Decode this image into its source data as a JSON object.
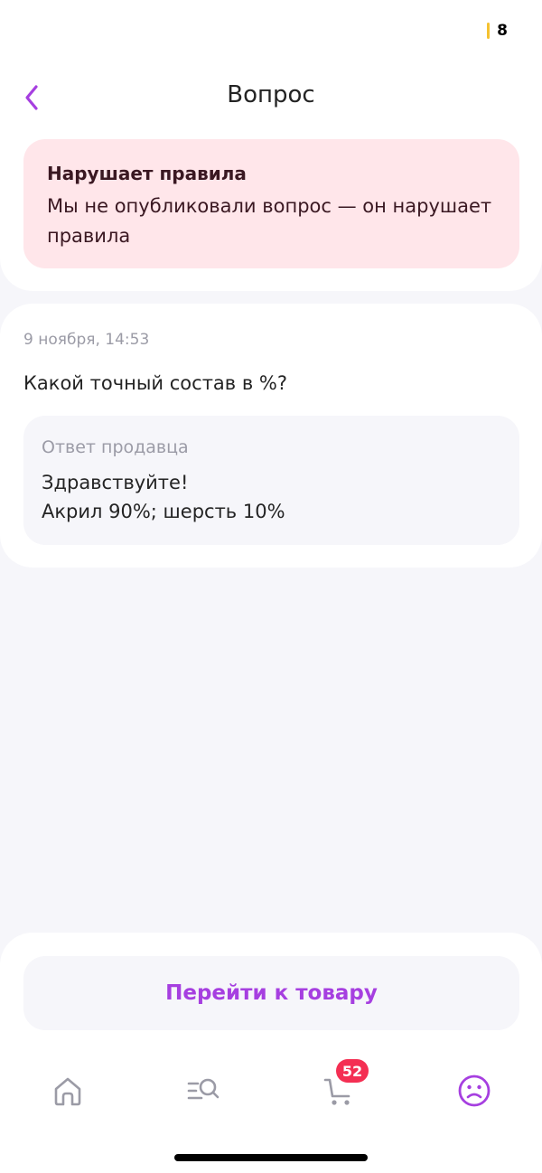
{
  "status_bar": {
    "battery_value": "8"
  },
  "header": {
    "title": "Вопрос"
  },
  "alert": {
    "title": "Нарушает правила",
    "text": "Мы не опубликовали вопрос — он нарушает правила"
  },
  "question": {
    "date": "9 ноября, 14:53",
    "text": "Какой точный состав в %?",
    "answer_label": "Ответ продавца",
    "answer_line1": "Здравствуйте!",
    "answer_line2": "Акрил 90%; шерсть 10%"
  },
  "actions": {
    "go_to_product": "Перейти к товару"
  },
  "tabbar": {
    "items": [
      {
        "icon": "home-icon"
      },
      {
        "icon": "catalog-search-icon"
      },
      {
        "icon": "cart-icon",
        "badge": "52"
      },
      {
        "icon": "profile-icon",
        "active": true
      }
    ]
  },
  "colors": {
    "accent": "#a63fe0",
    "alert_bg": "#ffe6ea",
    "badge": "#f42f53",
    "muted_text": "#9b9ba6",
    "inactive_icon": "#9b9ba6"
  }
}
